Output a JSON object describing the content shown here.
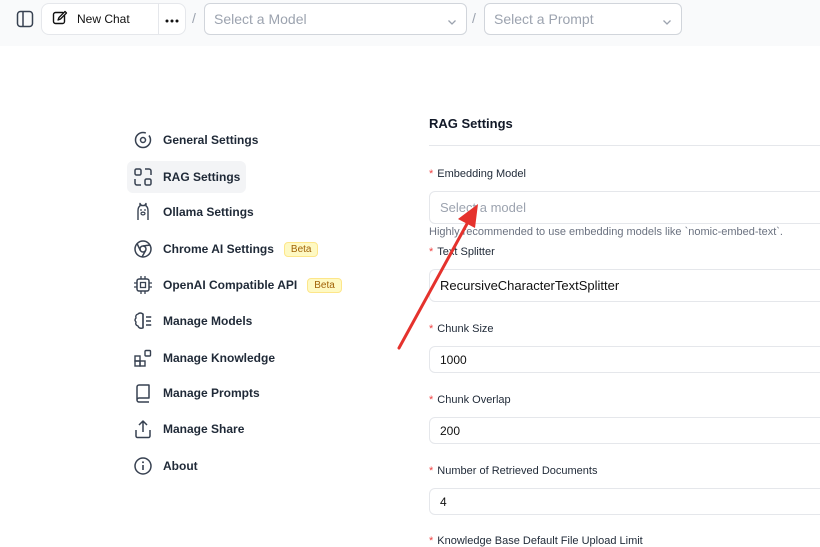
{
  "header": {
    "new_chat_label": "New Chat",
    "model_select_placeholder": "Select a Model",
    "prompt_select_placeholder": "Select a Prompt",
    "separator": "/"
  },
  "sidebar": {
    "items": [
      {
        "label": "General Settings",
        "icon": "gear-icon"
      },
      {
        "label": "RAG Settings",
        "icon": "rag-icon",
        "active": true
      },
      {
        "label": "Ollama Settings",
        "icon": "llama-icon"
      },
      {
        "label": "Chrome AI Settings",
        "icon": "chrome-icon",
        "badge": "Beta"
      },
      {
        "label": "OpenAI Compatible API",
        "icon": "chip-icon",
        "badge": "Beta"
      },
      {
        "label": "Manage Models",
        "icon": "brain-icon"
      },
      {
        "label": "Manage Knowledge",
        "icon": "blocks-icon"
      },
      {
        "label": "Manage Prompts",
        "icon": "book-icon"
      },
      {
        "label": "Manage Share",
        "icon": "share-icon"
      },
      {
        "label": "About",
        "icon": "info-icon"
      }
    ]
  },
  "main": {
    "title": "RAG Settings",
    "embedding_model": {
      "label": "Embedding Model",
      "placeholder": "Select a model",
      "helper": "Highly recommended to use embedding models like `nomic-embed-text`."
    },
    "text_splitter": {
      "label": "Text Splitter",
      "value": "RecursiveCharacterTextSplitter"
    },
    "chunk_size": {
      "label": "Chunk Size",
      "value": "1000"
    },
    "chunk_overlap": {
      "label": "Chunk Overlap",
      "value": "200"
    },
    "retrieved_docs": {
      "label": "Number of Retrieved Documents",
      "value": "4"
    },
    "upload_limit": {
      "label": "Knowledge Base Default File Upload Limit"
    }
  },
  "colors": {
    "accent_arrow": "#e5322d",
    "required_marker": "#ef4444",
    "beta_badge_bg": "#fef9c3"
  }
}
